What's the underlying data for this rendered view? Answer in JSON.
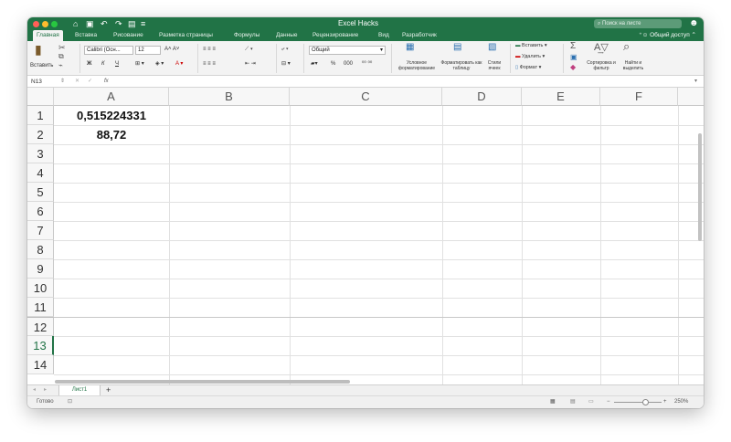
{
  "window": {
    "title": "Excel Hacks",
    "search_placeholder": "Поиск на листе",
    "share_label": "Общий доступ"
  },
  "ribbon_tabs": [
    "Главная",
    "Вставка",
    "Рисование",
    "Разметка страницы",
    "Формулы",
    "Данные",
    "Рецензирование",
    "Вид",
    "Разработчик"
  ],
  "ribbon": {
    "paste_label": "Вставить",
    "font_name": "Calibri (Осн...",
    "font_size": "12",
    "bold": "Ж",
    "italic": "К",
    "underline": "Ч",
    "number_format": "Общий",
    "percent": "%",
    "thousands": "000",
    "conditional_formatting": "Условное форматирование",
    "format_as_table": "Форматировать как таблицу",
    "cell_styles": "Стили ячеек",
    "insert": "Вставить",
    "delete": "Удалить",
    "format": "Формат",
    "sort_filter": "Сортировка и фильтр",
    "find_select": "Найти и выделить"
  },
  "formula_bar": {
    "name_box": "N13",
    "fx": "fx",
    "formula": ""
  },
  "columns": [
    "A",
    "B",
    "C",
    "D",
    "E",
    "F"
  ],
  "rows": [
    "1",
    "2",
    "3",
    "4",
    "5",
    "6",
    "7",
    "8",
    "9",
    "10",
    "11",
    "12",
    "13",
    "14"
  ],
  "cells": {
    "A1": "0,515224331",
    "A2": "88,72"
  },
  "sheet_tabs": [
    "Лист1"
  ],
  "add_sheet": "+",
  "status": {
    "ready": "Готово",
    "zoom": "250%",
    "zoom_minus": "−",
    "zoom_plus": "+"
  },
  "colors": {
    "accent": "#217346",
    "grid": "#e1e1e1"
  }
}
